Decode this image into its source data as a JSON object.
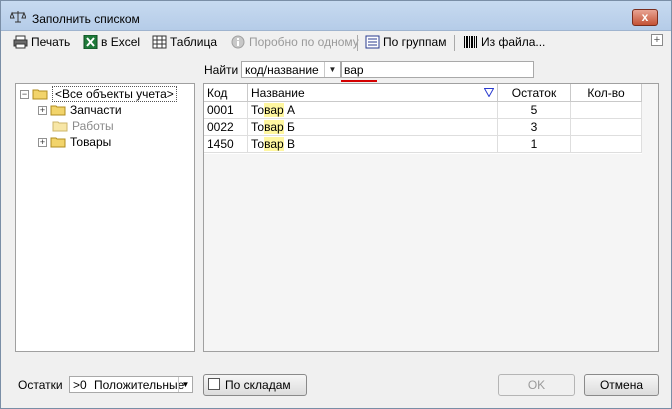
{
  "window": {
    "title": "Заполнить списком",
    "close_label": "x"
  },
  "toolbar": {
    "print": "Печать",
    "excel": "в Excel",
    "table": "Таблица",
    "one_by_one": "Поробно по одному",
    "by_groups": "По группам",
    "from_file": "Из файла...",
    "expand": "+"
  },
  "search": {
    "label": "Найти",
    "mode": "код/название",
    "query": "вар"
  },
  "tree": {
    "root": "<Все объекты учета>",
    "items": [
      {
        "label": "Запчасти",
        "expander": "+"
      },
      {
        "label": "Работы"
      },
      {
        "label": "Товары",
        "expander": "+"
      }
    ],
    "root_expander": "−"
  },
  "grid": {
    "columns": [
      "Код",
      "Название",
      "Остаток",
      "Кол-во"
    ],
    "rows": [
      {
        "code": "0001",
        "name_pre": "То",
        "name_hl": "вар",
        "name_post": " А",
        "stock": "5",
        "qty": ""
      },
      {
        "code": "0022",
        "name_pre": "То",
        "name_hl": "вар",
        "name_post": " Б",
        "stock": "3",
        "qty": ""
      },
      {
        "code": "1450",
        "name_pre": "То",
        "name_hl": "вар",
        "name_post": " В",
        "stock": "1",
        "qty": ""
      }
    ]
  },
  "bottom": {
    "rest_label": "Остатки",
    "rest_op": ">0",
    "rest_value": "Положительные",
    "by_warehouses": "По складам",
    "ok": "OK",
    "cancel": "Отмена"
  }
}
